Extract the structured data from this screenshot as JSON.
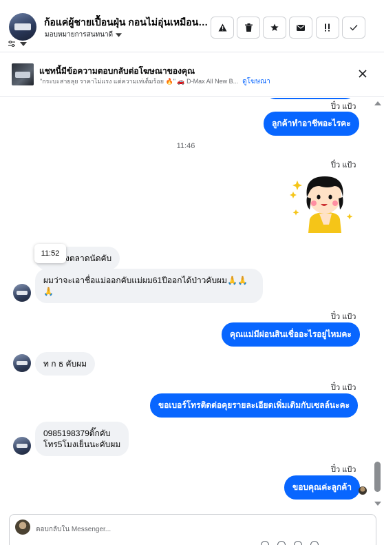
{
  "header": {
    "title": "ก้อแค่ผู้ชายเปื้อนฝุ่น กอนไม่อุ่นเหมือนคน...",
    "assign_label": "มอบหมายการสนทนาดี",
    "actions": [
      "alert-icon",
      "trash-icon",
      "star-icon",
      "envelope-icon",
      "exclamation-icon",
      "check-icon"
    ]
  },
  "ad_bar": {
    "heading": "แชทนี้มีข้อความตอบกลับต่อโฆษณาของคุณ",
    "snippet": "\"กระบะสายลุย ราคาไม่แรง แต่ความเท่เต็มร้อย 🔥\" 🚗 D-Max All New B...",
    "link": "ดูโฆษณา"
  },
  "messages": {
    "s1": "ปิ๋ว แป้ว",
    "m1": "ลูกค้าทำอาชีพอะไรคะ",
    "time_sep": "11:46",
    "s2": "ปิ๋ว แป้ว",
    "tooltip_time": "11:52",
    "m_in1": "งตลาดนัดคับ",
    "m_in2_line1": "ผมว่าจะเอาชื่อแม่ออกคับแม่ผม61ปีออกได้ป่าวคับผม🙏🙏",
    "m_in2_line2": "🙏",
    "s3": "ปิ๋ว แป้ว",
    "m2": "คุณแม่มีผ่อนสินเชื่ออะไรอยู่ไหมคะ",
    "m_in3": "ท ก ธ คับผม",
    "s4": "ปิ๋ว แป้ว",
    "m3": "ขอเบอร์โทรติดต่อคุยรายละเอียดเพิ่มเติมกับเซลล์นะคะ",
    "m_in4_line1": "0985198379ติ๊กคับ",
    "m_in4_line2": "โทร5โมงเย็นนะคับผม",
    "s5": "ปิ๋ว แป้ว",
    "m4": "ขอบคุณค่ะลูกค้า"
  },
  "composer": {
    "placeholder": "ตอบกลับใน Messenger..."
  },
  "colors": {
    "outgoing": "#0866ff",
    "incoming": "#f0f2f5"
  }
}
